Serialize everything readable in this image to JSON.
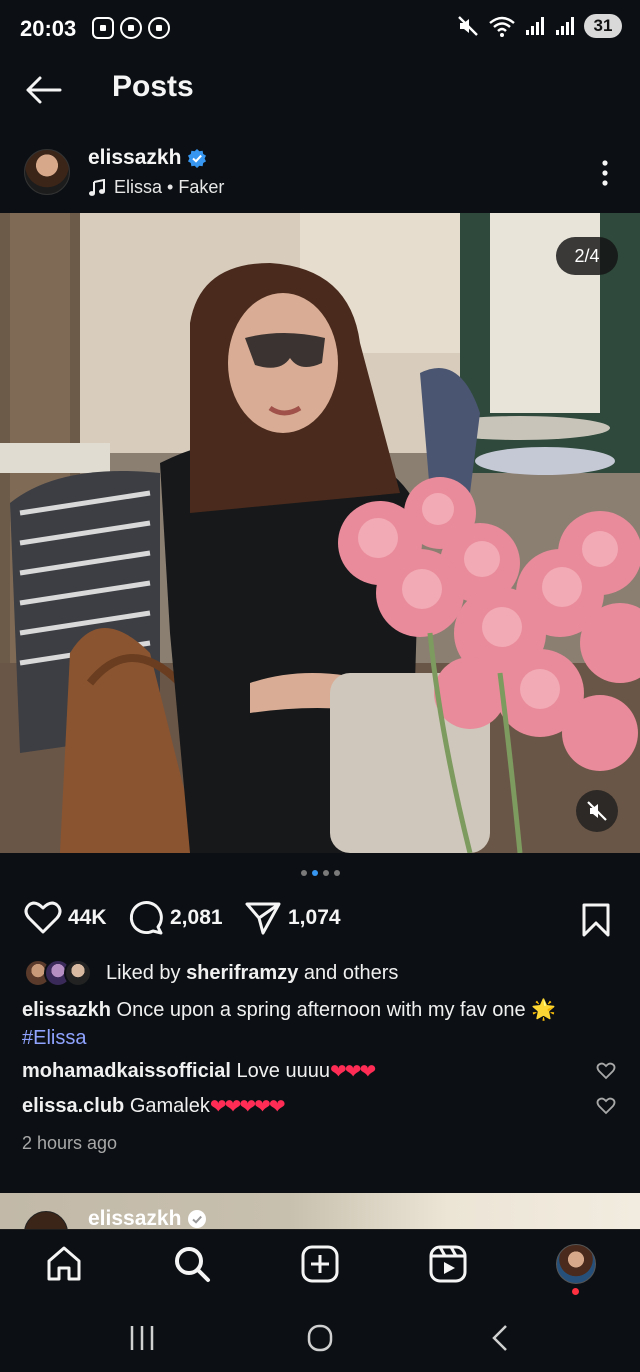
{
  "status_bar": {
    "time": "20:03",
    "battery": "31",
    "icons": [
      "screenshot-icon",
      "notification-icon",
      "notification-icon",
      "mute-icon",
      "wifi-icon",
      "signal-icon",
      "signal-icon"
    ]
  },
  "header": {
    "title": "Posts"
  },
  "post": {
    "username": "elissazkh",
    "verified": true,
    "audio": "Elissa • Faker",
    "media_counter": "2/4",
    "carousel_count": 4,
    "carousel_active": 2,
    "likes": "44K",
    "comments_count": "2,081",
    "shares": "1,074",
    "liked_by_prefix": "Liked by ",
    "liked_by_user": "sheriframzy",
    "liked_by_suffix": " and others",
    "caption_user": "elissazkh",
    "caption_text": " Once upon a spring afternoon with my fav one 🌟",
    "caption_hashtag": "#Elissa",
    "comments": [
      {
        "user": "mohamadkaissofficial",
        "text": " Love uuuu",
        "hearts": "❤❤❤"
      },
      {
        "user": "elissa.club",
        "text": " Gamalek",
        "hearts": "❤❤❤❤❤"
      }
    ],
    "time_ago": "2 hours ago"
  },
  "next_post": {
    "username": "elissazkh"
  },
  "colors": {
    "background": "#0c1014",
    "accent_blue": "#3797f0",
    "hashtag": "#8fa3ff",
    "heart_red": "#ff2d55"
  }
}
